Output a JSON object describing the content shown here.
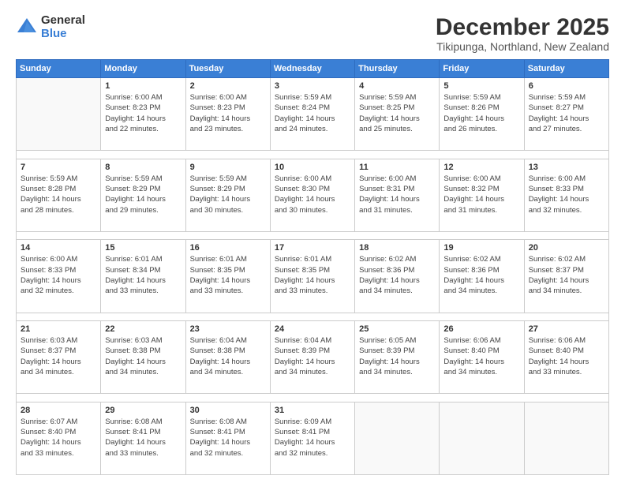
{
  "logo": {
    "general": "General",
    "blue": "Blue"
  },
  "header": {
    "month": "December 2025",
    "location": "Tikipunga, Northland, New Zealand"
  },
  "days_of_week": [
    "Sunday",
    "Monday",
    "Tuesday",
    "Wednesday",
    "Thursday",
    "Friday",
    "Saturday"
  ],
  "weeks": [
    [
      {
        "num": "",
        "info": ""
      },
      {
        "num": "1",
        "info": "Sunrise: 6:00 AM\nSunset: 8:23 PM\nDaylight: 14 hours\nand 22 minutes."
      },
      {
        "num": "2",
        "info": "Sunrise: 6:00 AM\nSunset: 8:23 PM\nDaylight: 14 hours\nand 23 minutes."
      },
      {
        "num": "3",
        "info": "Sunrise: 5:59 AM\nSunset: 8:24 PM\nDaylight: 14 hours\nand 24 minutes."
      },
      {
        "num": "4",
        "info": "Sunrise: 5:59 AM\nSunset: 8:25 PM\nDaylight: 14 hours\nand 25 minutes."
      },
      {
        "num": "5",
        "info": "Sunrise: 5:59 AM\nSunset: 8:26 PM\nDaylight: 14 hours\nand 26 minutes."
      },
      {
        "num": "6",
        "info": "Sunrise: 5:59 AM\nSunset: 8:27 PM\nDaylight: 14 hours\nand 27 minutes."
      }
    ],
    [
      {
        "num": "7",
        "info": "Sunrise: 5:59 AM\nSunset: 8:28 PM\nDaylight: 14 hours\nand 28 minutes."
      },
      {
        "num": "8",
        "info": "Sunrise: 5:59 AM\nSunset: 8:29 PM\nDaylight: 14 hours\nand 29 minutes."
      },
      {
        "num": "9",
        "info": "Sunrise: 5:59 AM\nSunset: 8:29 PM\nDaylight: 14 hours\nand 30 minutes."
      },
      {
        "num": "10",
        "info": "Sunrise: 6:00 AM\nSunset: 8:30 PM\nDaylight: 14 hours\nand 30 minutes."
      },
      {
        "num": "11",
        "info": "Sunrise: 6:00 AM\nSunset: 8:31 PM\nDaylight: 14 hours\nand 31 minutes."
      },
      {
        "num": "12",
        "info": "Sunrise: 6:00 AM\nSunset: 8:32 PM\nDaylight: 14 hours\nand 31 minutes."
      },
      {
        "num": "13",
        "info": "Sunrise: 6:00 AM\nSunset: 8:33 PM\nDaylight: 14 hours\nand 32 minutes."
      }
    ],
    [
      {
        "num": "14",
        "info": "Sunrise: 6:00 AM\nSunset: 8:33 PM\nDaylight: 14 hours\nand 32 minutes."
      },
      {
        "num": "15",
        "info": "Sunrise: 6:01 AM\nSunset: 8:34 PM\nDaylight: 14 hours\nand 33 minutes."
      },
      {
        "num": "16",
        "info": "Sunrise: 6:01 AM\nSunset: 8:35 PM\nDaylight: 14 hours\nand 33 minutes."
      },
      {
        "num": "17",
        "info": "Sunrise: 6:01 AM\nSunset: 8:35 PM\nDaylight: 14 hours\nand 33 minutes."
      },
      {
        "num": "18",
        "info": "Sunrise: 6:02 AM\nSunset: 8:36 PM\nDaylight: 14 hours\nand 34 minutes."
      },
      {
        "num": "19",
        "info": "Sunrise: 6:02 AM\nSunset: 8:36 PM\nDaylight: 14 hours\nand 34 minutes."
      },
      {
        "num": "20",
        "info": "Sunrise: 6:02 AM\nSunset: 8:37 PM\nDaylight: 14 hours\nand 34 minutes."
      }
    ],
    [
      {
        "num": "21",
        "info": "Sunrise: 6:03 AM\nSunset: 8:37 PM\nDaylight: 14 hours\nand 34 minutes."
      },
      {
        "num": "22",
        "info": "Sunrise: 6:03 AM\nSunset: 8:38 PM\nDaylight: 14 hours\nand 34 minutes."
      },
      {
        "num": "23",
        "info": "Sunrise: 6:04 AM\nSunset: 8:38 PM\nDaylight: 14 hours\nand 34 minutes."
      },
      {
        "num": "24",
        "info": "Sunrise: 6:04 AM\nSunset: 8:39 PM\nDaylight: 14 hours\nand 34 minutes."
      },
      {
        "num": "25",
        "info": "Sunrise: 6:05 AM\nSunset: 8:39 PM\nDaylight: 14 hours\nand 34 minutes."
      },
      {
        "num": "26",
        "info": "Sunrise: 6:06 AM\nSunset: 8:40 PM\nDaylight: 14 hours\nand 34 minutes."
      },
      {
        "num": "27",
        "info": "Sunrise: 6:06 AM\nSunset: 8:40 PM\nDaylight: 14 hours\nand 33 minutes."
      }
    ],
    [
      {
        "num": "28",
        "info": "Sunrise: 6:07 AM\nSunset: 8:40 PM\nDaylight: 14 hours\nand 33 minutes."
      },
      {
        "num": "29",
        "info": "Sunrise: 6:08 AM\nSunset: 8:41 PM\nDaylight: 14 hours\nand 33 minutes."
      },
      {
        "num": "30",
        "info": "Sunrise: 6:08 AM\nSunset: 8:41 PM\nDaylight: 14 hours\nand 32 minutes."
      },
      {
        "num": "31",
        "info": "Sunrise: 6:09 AM\nSunset: 8:41 PM\nDaylight: 14 hours\nand 32 minutes."
      },
      {
        "num": "",
        "info": ""
      },
      {
        "num": "",
        "info": ""
      },
      {
        "num": "",
        "info": ""
      }
    ]
  ]
}
